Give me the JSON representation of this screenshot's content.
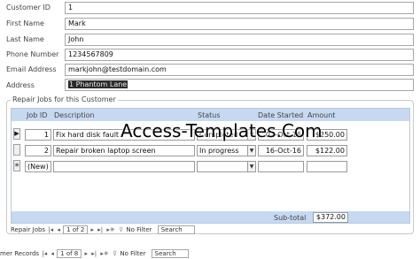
{
  "form": {
    "fields": [
      {
        "label": "Customer ID",
        "value": "1"
      },
      {
        "label": "First Name",
        "value": "Mark"
      },
      {
        "label": "Last Name",
        "value": "John"
      },
      {
        "label": "Phone Number",
        "value": "1234567809"
      },
      {
        "label": "Email Address",
        "value": "markjohn@testdomain.com"
      },
      {
        "label": "Address",
        "value": "1 Phantom Lane"
      }
    ]
  },
  "repair_jobs": {
    "title": "Repair Jobs for this Customer",
    "columns": [
      "Job ID",
      "Description",
      "Status",
      "Date Started",
      "Amount"
    ],
    "rows": [
      {
        "selector": "▶",
        "job_id": "1",
        "description": "Fix hard disk fault",
        "status": "Completed",
        "date_started": "02-Oct-16",
        "amount": "$250.00"
      },
      {
        "selector": "",
        "job_id": "2",
        "description": "Repair broken laptop screen",
        "status": "In progress",
        "date_started": "16-Oct-16",
        "amount": "$122.00"
      },
      {
        "selector": "✳",
        "job_id": "(New)",
        "description": "",
        "status": "",
        "date_started": "",
        "amount": ""
      }
    ],
    "subtotal_label": "Sub-total",
    "subtotal_value": "$372.00",
    "nav": {
      "label": "Repair Jobs",
      "record": "1 of 2",
      "filter": "No Filter",
      "search": "Search"
    }
  },
  "main_nav": {
    "label": "mer Records",
    "record": "1 of 8",
    "filter": "No Filter",
    "search": "Search"
  },
  "watermark": "Access-Templates.Com",
  "icons": {
    "first": "first-record-icon",
    "prev": "previous-record-icon",
    "next": "next-record-icon",
    "last": "last-record-icon",
    "new": "new-record-icon",
    "filter": "filter-icon"
  }
}
